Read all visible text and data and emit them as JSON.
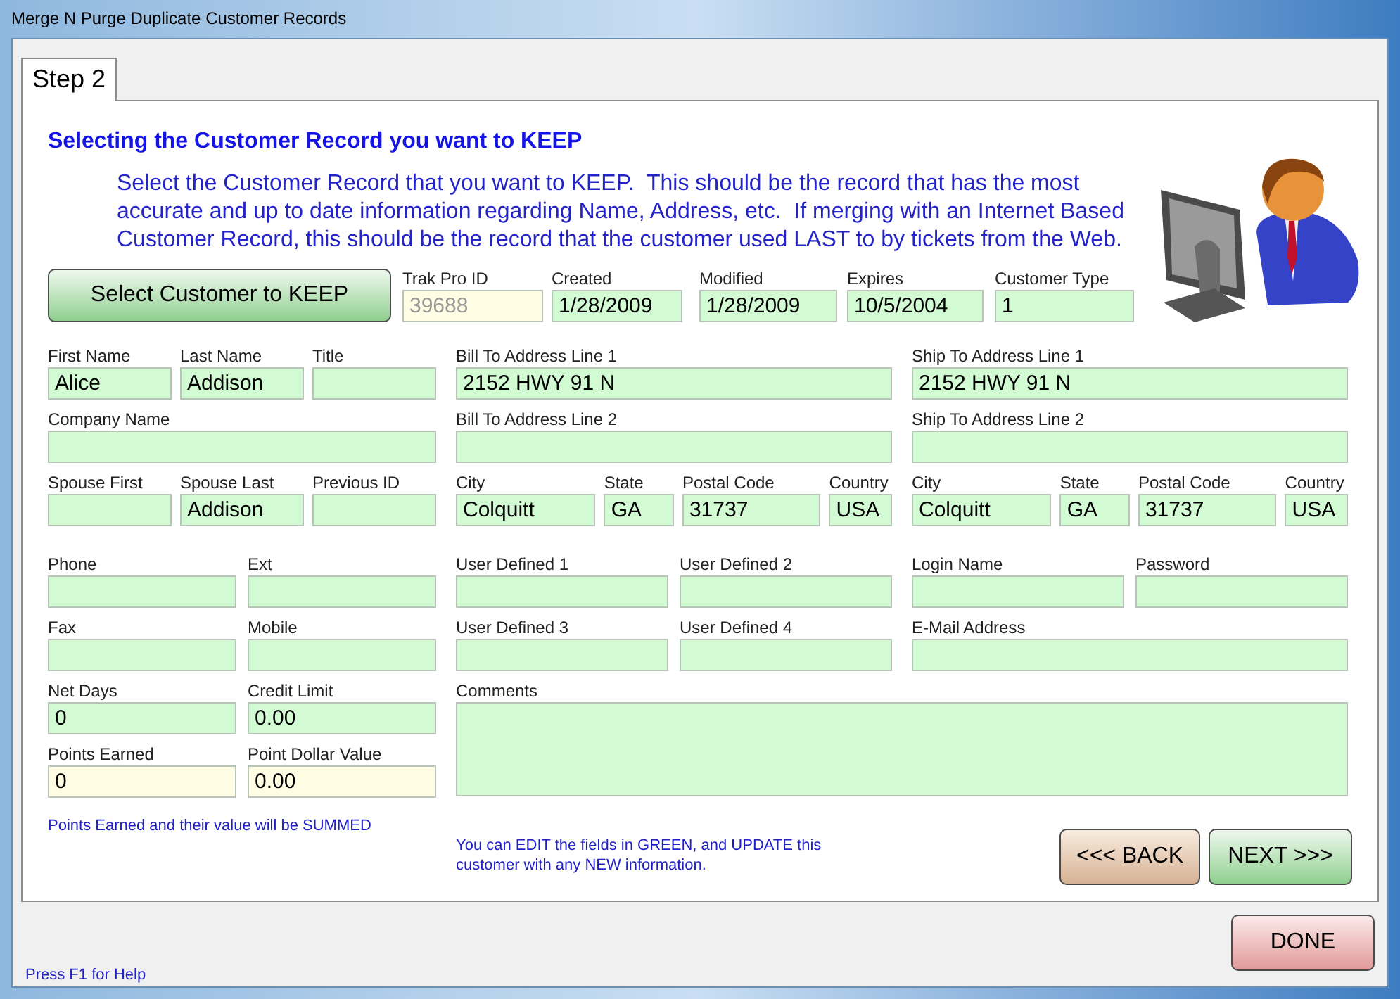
{
  "window": {
    "title": "Merge N Purge Duplicate Customer Records"
  },
  "tabs": [
    {
      "label": "Step 2",
      "selected": true
    }
  ],
  "heading": "Selecting the Customer Record you want to KEEP",
  "instructions": "Select the Customer Record that you want to KEEP.  This should be the record that has the most accurate and up to date information regarding Name, Address, etc.  If merging with an Internet Based Customer Record, this should be the record that the customer used LAST to by tickets from the Web.",
  "select_button": "Select Customer to KEEP",
  "record_fields": [
    {
      "label": "Trak Pro ID",
      "value": "39688",
      "kind": "locked"
    },
    {
      "label": "Created",
      "value": "1/28/2009",
      "kind": "editable"
    },
    {
      "label": "Modified",
      "value": "1/28/2009",
      "kind": "editable"
    },
    {
      "label": "Expires",
      "value": "10/5/2004",
      "kind": "editable"
    },
    {
      "label": "Customer Type",
      "value": "1",
      "kind": "editable"
    }
  ],
  "left_column": {
    "rows": [
      [
        {
          "label": "First Name",
          "value": "Alice",
          "kind": "editable"
        },
        {
          "label": "Last Name",
          "value": "Addison",
          "kind": "editable"
        },
        {
          "label": "Title",
          "kind": "editable"
        }
      ],
      [
        {
          "label": "Company Name",
          "kind": "editable"
        }
      ],
      [
        {
          "label": "Spouse First",
          "kind": "editable"
        },
        {
          "label": "Spouse Last",
          "value": "Addison",
          "kind": "editable"
        },
        {
          "label": "Previous ID",
          "kind": "editable"
        }
      ],
      [
        {
          "label": "Phone",
          "kind": "editable"
        },
        {
          "label": "Ext",
          "kind": "editable"
        }
      ],
      [
        {
          "label": "Fax",
          "kind": "editable"
        },
        {
          "label": "Mobile",
          "kind": "editable"
        }
      ],
      [
        {
          "label": "Net Days",
          "value": "0",
          "kind": "editable"
        },
        {
          "label": "Credit Limit",
          "value": "0.00",
          "kind": "editable"
        }
      ],
      [
        {
          "label": "Points Earned",
          "value": "0",
          "kind": "summed"
        },
        {
          "label": "Point Dollar Value",
          "value": "0.00",
          "kind": "summed"
        }
      ]
    ]
  },
  "middle_column": {
    "rows": [
      [
        {
          "label": "Bill To Address Line 1",
          "value": "2152 HWY 91 N",
          "kind": "editable"
        }
      ],
      [
        {
          "label": "Bill To Address Line 2",
          "kind": "editable"
        }
      ],
      [
        {
          "label": "City",
          "value": "Colquitt",
          "kind": "editable"
        },
        {
          "label": "State",
          "value": "GA",
          "kind": "editable"
        },
        {
          "label": "Postal Code",
          "value": "31737",
          "kind": "editable"
        },
        {
          "label": "Country",
          "value": "USA",
          "kind": "editable"
        }
      ],
      [
        {
          "label": "User Defined 1",
          "kind": "editable"
        },
        {
          "label": "User Defined 2",
          "kind": "editable"
        }
      ],
      [
        {
          "label": "User Defined 3",
          "kind": "editable"
        },
        {
          "label": "User Defined 4",
          "kind": "editable"
        }
      ]
    ]
  },
  "right_column": {
    "rows": [
      [
        {
          "label": "Ship To Address Line 1",
          "value": "2152 HWY 91 N",
          "kind": "editable"
        }
      ],
      [
        {
          "label": "Ship To Address Line 2",
          "kind": "editable"
        }
      ],
      [
        {
          "label": "City",
          "value": "Colquitt",
          "kind": "editable"
        },
        {
          "label": "State",
          "value": "GA",
          "kind": "editable"
        },
        {
          "label": "Postal Code",
          "value": "31737",
          "kind": "editable"
        },
        {
          "label": "Country",
          "value": "USA",
          "kind": "editable"
        }
      ],
      [
        {
          "label": "Login Name",
          "kind": "editable"
        },
        "",
        {
          "label": "Password",
          "kind": "editable"
        }
      ],
      [
        {
          "label": "E-Mail Address",
          "kind": "editable"
        }
      ]
    ]
  },
  "comments": {
    "label": "Comments",
    "kind": "editable"
  },
  "points_note": "Points Earned and their value will be SUMMED",
  "edit_note": "You can EDIT the fields in GREEN, and UPDATE this customer with any NEW information.",
  "back_button": "<<< BACK",
  "next_button": "NEXT >>>",
  "done_button": "DONE",
  "status": "Press F1 for Help"
}
